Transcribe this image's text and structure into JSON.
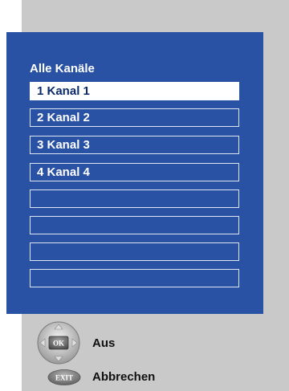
{
  "menu": {
    "title": "Alle Kanäle",
    "channels": [
      "1  Kanal 1",
      "2  Kanal 2",
      "3  Kanal 3",
      "4  Kanal 4",
      "",
      "",
      "",
      ""
    ]
  },
  "legend": {
    "ok_key": "OK",
    "ok_action": "Aus",
    "exit_key": "EXIT",
    "exit_action": "Abbrechen"
  },
  "colors": {
    "panel_blue": "#2952a4",
    "background_gray": "#c9c9c9",
    "selected_bg": "#ffffff"
  }
}
